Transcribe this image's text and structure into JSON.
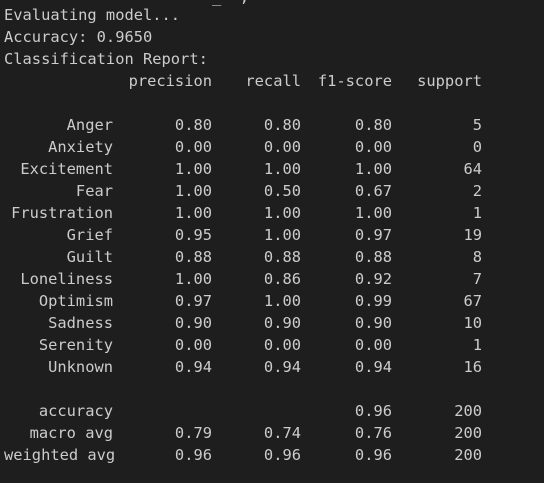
{
  "output": {
    "partial_top": "_  ,",
    "evaluating": "Evaluating model...",
    "accuracy_line": "Accuracy: 0.9650",
    "report_title": "Classification Report:"
  },
  "report": {
    "headers": [
      "precision",
      "recall",
      "f1-score",
      "support"
    ],
    "rows": [
      {
        "label": "Anger",
        "precision": "0.80",
        "recall": "0.80",
        "f1": "0.80",
        "support": "5"
      },
      {
        "label": "Anxiety",
        "precision": "0.00",
        "recall": "0.00",
        "f1": "0.00",
        "support": "0"
      },
      {
        "label": "Excitement",
        "precision": "1.00",
        "recall": "1.00",
        "f1": "1.00",
        "support": "64"
      },
      {
        "label": "Fear",
        "precision": "1.00",
        "recall": "0.50",
        "f1": "0.67",
        "support": "2"
      },
      {
        "label": "Frustration",
        "precision": "1.00",
        "recall": "1.00",
        "f1": "1.00",
        "support": "1"
      },
      {
        "label": "Grief",
        "precision": "0.95",
        "recall": "1.00",
        "f1": "0.97",
        "support": "19"
      },
      {
        "label": "Guilt",
        "precision": "0.88",
        "recall": "0.88",
        "f1": "0.88",
        "support": "8"
      },
      {
        "label": "Loneliness",
        "precision": "1.00",
        "recall": "0.86",
        "f1": "0.92",
        "support": "7"
      },
      {
        "label": "Optimism",
        "precision": "0.97",
        "recall": "1.00",
        "f1": "0.99",
        "support": "67"
      },
      {
        "label": "Sadness",
        "precision": "0.90",
        "recall": "0.90",
        "f1": "0.90",
        "support": "10"
      },
      {
        "label": "Serenity",
        "precision": "0.00",
        "recall": "0.00",
        "f1": "0.00",
        "support": "1"
      },
      {
        "label": "Unknown",
        "precision": "0.94",
        "recall": "0.94",
        "f1": "0.94",
        "support": "16"
      }
    ],
    "summary": [
      {
        "label": "accuracy",
        "precision": "",
        "recall": "",
        "f1": "0.96",
        "support": "200"
      },
      {
        "label": "macro avg",
        "precision": "0.79",
        "recall": "0.74",
        "f1": "0.76",
        "support": "200"
      },
      {
        "label": "weighted avg",
        "precision": "0.96",
        "recall": "0.96",
        "f1": "0.96",
        "support": "200"
      }
    ]
  }
}
